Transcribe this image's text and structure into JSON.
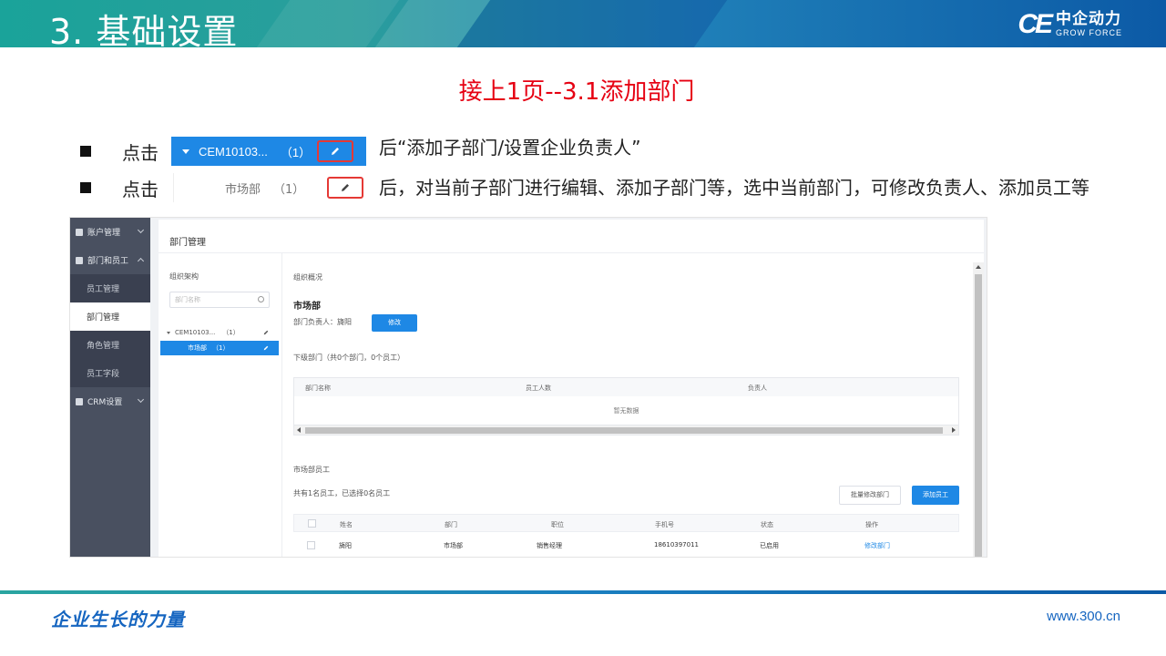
{
  "header": {
    "title": "3. 基础设置",
    "logo_mark": "CE",
    "logo_cn": "中企动力",
    "logo_en": "GROW FORCE"
  },
  "subtitle": "接上1页--3.1添加部门",
  "bullets": [
    {
      "lead": "点击",
      "snippet_label": "CEM10103...",
      "snippet_count": "（1）",
      "tail": "后“添加子部门/设置企业负责人”"
    },
    {
      "lead": "点击",
      "snippet_label": "市场部",
      "snippet_count": "（1）",
      "tail": "后，对当前子部门进行编辑、添加子部门等，选中当前部门，可修改负责人、添加员工等"
    }
  ],
  "app": {
    "sidebar": {
      "items": [
        {
          "label": "账户管理",
          "level": "top"
        },
        {
          "label": "部门和员工",
          "level": "top"
        },
        {
          "label": "员工管理",
          "level": "sub"
        },
        {
          "label": "部门管理",
          "level": "sub",
          "active": true
        },
        {
          "label": "角色管理",
          "level": "sub"
        },
        {
          "label": "员工字段",
          "level": "sub"
        },
        {
          "label": "CRM设置",
          "level": "top"
        }
      ]
    },
    "panel_title": "部门管理",
    "tree": {
      "label": "组织架构",
      "search_placeholder": "部门名称",
      "root_label": "CEM10103...",
      "root_count": "（1）",
      "child_label": "市场部",
      "child_count": "（1）"
    },
    "overview_label": "组织概况",
    "dept_name": "市场部",
    "dept_head_label": "部门负责人：",
    "dept_head_name": "旖阳",
    "edit_button": "修改",
    "sub_title": "下级部门（共0个部门，0个员工）",
    "sub_table": {
      "headers": [
        "部门名称",
        "员工人数",
        "负责人"
      ],
      "empty_text": "暂无数据"
    },
    "employees_title": "市场部员工",
    "employees_count_text": "共有1名员工，已选择0名员工",
    "batch_button": "批量修改部门",
    "add_employee_button": "添加员工",
    "emp_table": {
      "headers": [
        "姓名",
        "部门",
        "职位",
        "手机号",
        "状态",
        "操作"
      ],
      "rows": [
        {
          "name": "旖阳",
          "dept": "市场部",
          "position": "销售经理",
          "phone": "18610397011",
          "status": "已启用",
          "action": "修改部门"
        }
      ]
    }
  },
  "footer": {
    "slogan": "企业生长的力量",
    "url": "www.300.cn"
  },
  "colors": {
    "accent_blue": "#1e88e5",
    "highlight_red": "#e53935",
    "subtitle_red": "#e60012",
    "sidebar_bg": "#495060"
  }
}
